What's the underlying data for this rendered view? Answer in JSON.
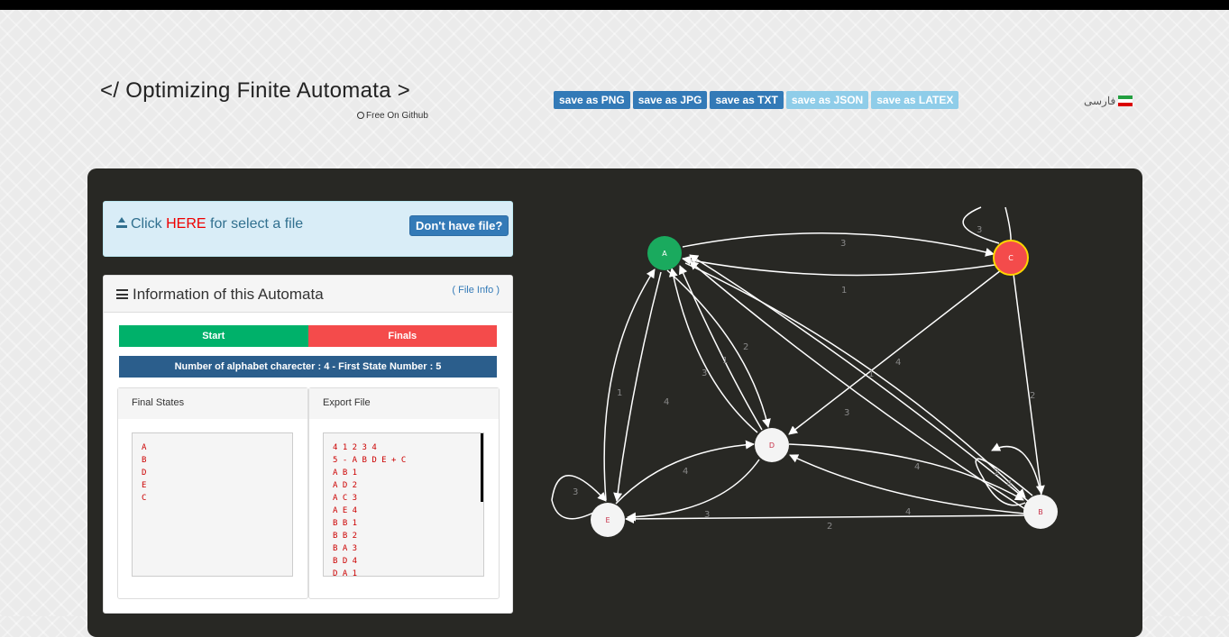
{
  "header": {
    "title": "</ Optimizing Finite Automata >",
    "github": "Free On Github",
    "language": "فارسی"
  },
  "save_buttons": [
    "save as PNG",
    "save as JPG",
    "save as TXT",
    "save as JSON",
    "save as LATEX"
  ],
  "file": {
    "click": "Click",
    "here": "HERE",
    "rest": "for select a file",
    "no_file_button": "Don't have file?"
  },
  "info": {
    "title": "Information of this Automata",
    "file_info": "( File Info )",
    "start_label": "Start",
    "finals_label": "Finals",
    "alphabet": "Number of alphabet charecter : 4 - First State Number : 5",
    "final_states_title": "Final States",
    "final_states_text": "A\nB\nD\nE\nC",
    "export_title": "Export File",
    "export_text": "4 1 2 3 4\n5 - A B D E + C\nA B 1\nA D 2\nA C 3\nA E 4\nB B 1\nB B 2\nB A 3\nB D 4\nD A 1"
  },
  "colors": {
    "start": "#00b16a",
    "finals": "#f44b4b",
    "alphabet_bar": "#2b5e8c",
    "start_node": "#1aaa5e",
    "final_node": "#f44b4b",
    "final_node_border": "#ffd700",
    "node": "#f4f4f4"
  },
  "graph": {
    "nodes": [
      "A",
      "C",
      "D",
      "E",
      "B"
    ],
    "edge_labels": [
      "3",
      "1",
      "3",
      "4",
      "2",
      "2",
      "3",
      "1",
      "4",
      "1",
      "1",
      "4",
      "3",
      "4",
      "2",
      "4",
      "4",
      "3",
      "2",
      "3"
    ]
  }
}
